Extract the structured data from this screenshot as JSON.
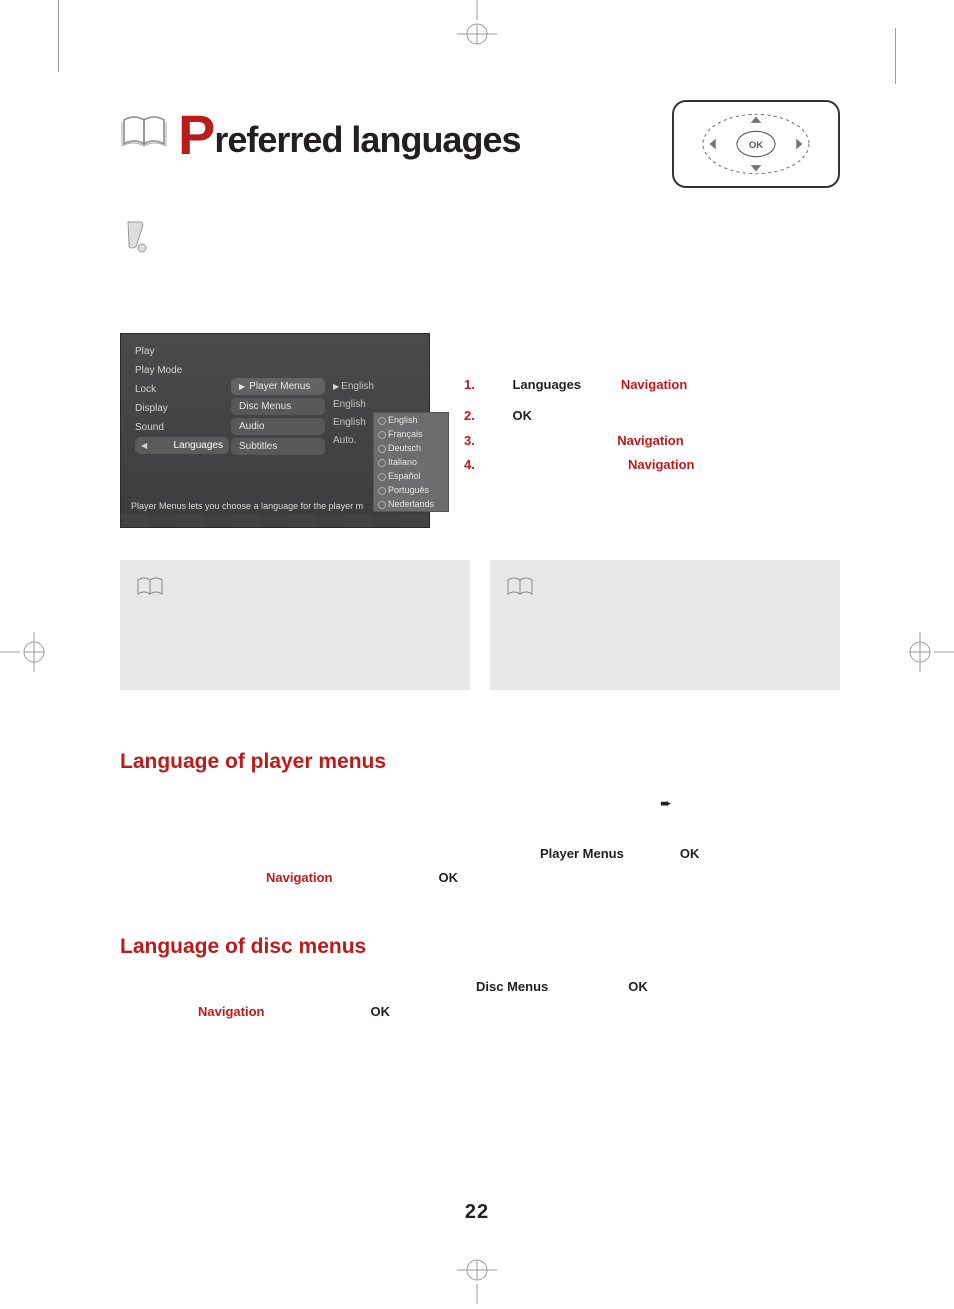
{
  "title": {
    "bigLetter": "P",
    "rest": "referred languages"
  },
  "osd": {
    "left": [
      "Play",
      "Play Mode",
      "Lock",
      "Display",
      "Sound",
      "Languages"
    ],
    "mid": [
      "Player Menus",
      "Disc Menus",
      "Audio",
      "Subtitles"
    ],
    "vals": [
      "English",
      "English",
      "English",
      "Auto."
    ],
    "popup": [
      "English",
      "Français",
      "Deutsch",
      "Italiano",
      "Español",
      "Português",
      "Nederlands"
    ],
    "helper": "Player Menus lets you choose a language for the player m"
  },
  "steps": {
    "s1": {
      "num": "1.",
      "kw1": "Languages",
      "nav": "Navigation"
    },
    "s2": {
      "num": "2.",
      "kw1": "OK"
    },
    "s3": {
      "num": "3.",
      "nav": "Navigation"
    },
    "s4": {
      "num": "4.",
      "nav": "Navigation"
    }
  },
  "sections": {
    "playerMenus": {
      "heading": "Language of player menus",
      "playerMenus": "Player  Menus",
      "ok1": "OK",
      "nav": "Navigation",
      "ok2": "OK",
      "arrow": "➨"
    },
    "discMenus": {
      "heading": "Language of disc menus",
      "discMenus": "Disc Menus",
      "ok1": "OK",
      "nav": "Navigation",
      "ok2": "OK"
    }
  },
  "pageNumber": "22"
}
